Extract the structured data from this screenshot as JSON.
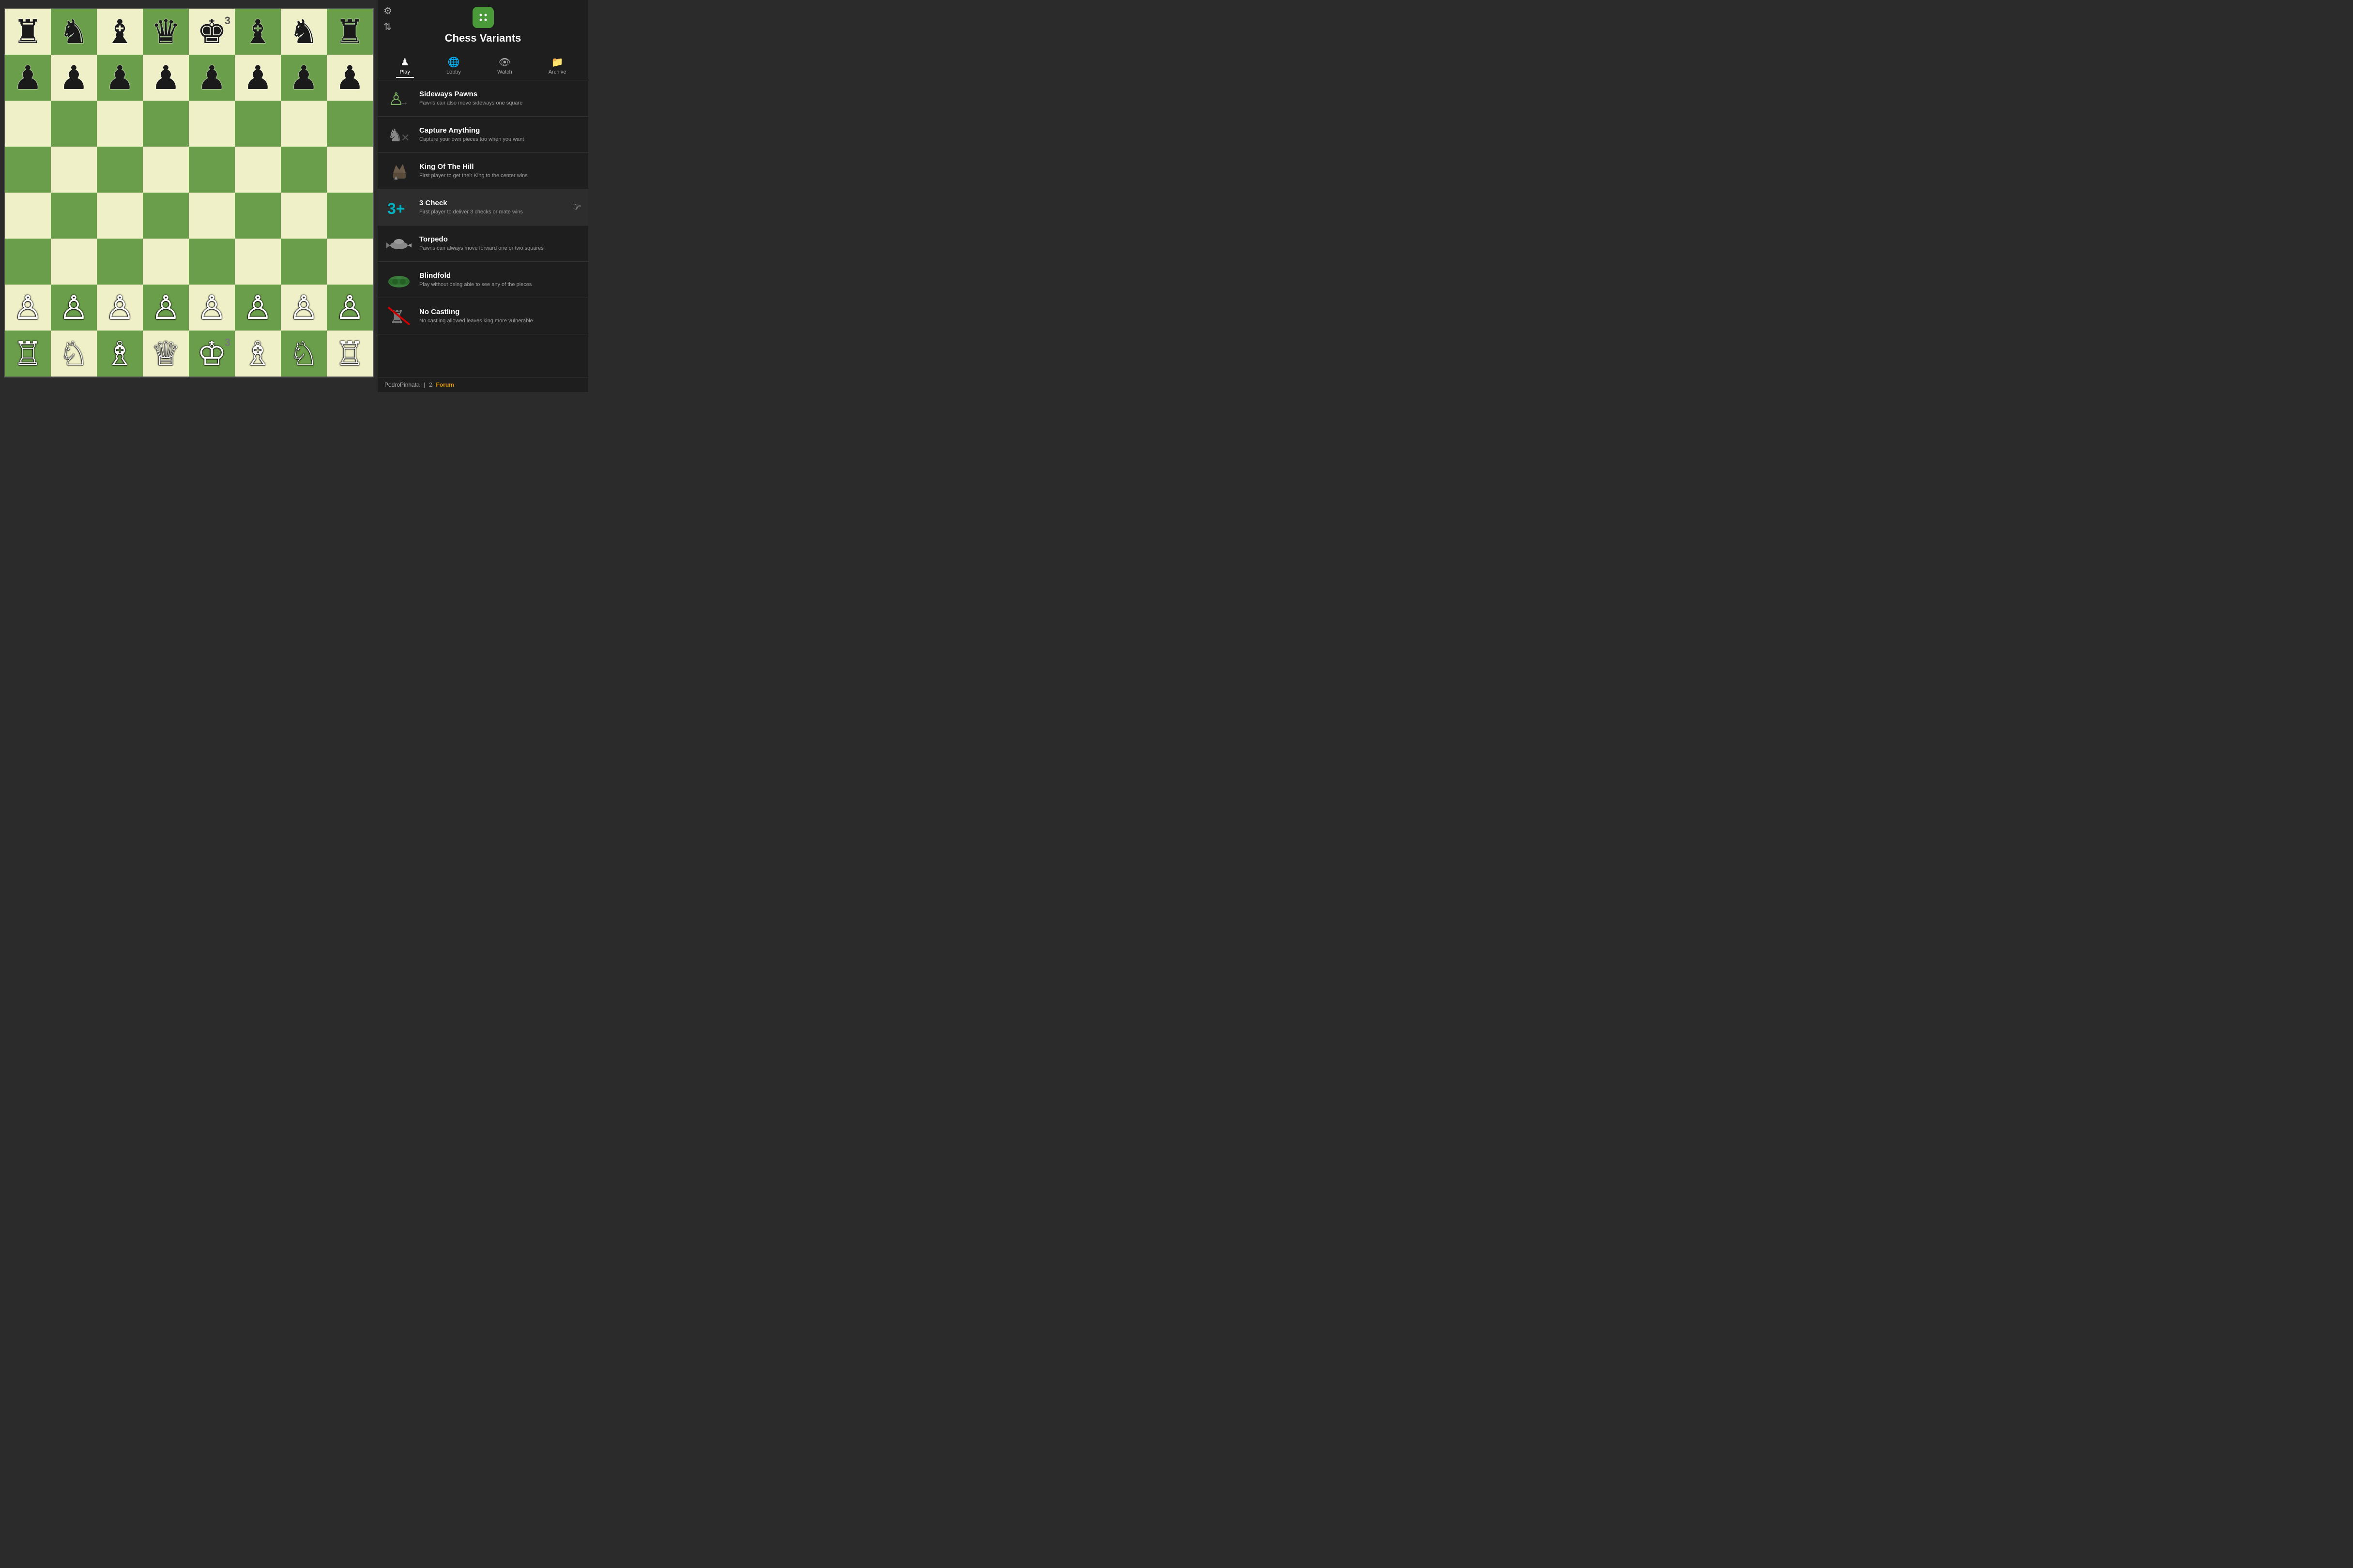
{
  "panel": {
    "title": "Chess Variants",
    "dice_icon": "🎲"
  },
  "nav": {
    "tabs": [
      {
        "id": "play",
        "label": "Play",
        "icon": "♟",
        "active": true
      },
      {
        "id": "lobby",
        "label": "Lobby",
        "icon": "🌐",
        "active": false
      },
      {
        "id": "watch",
        "label": "Watch",
        "icon": "👁",
        "active": false
      },
      {
        "id": "archive",
        "label": "Archive",
        "icon": "📁",
        "active": false
      }
    ]
  },
  "variants": [
    {
      "id": "sideways-pawns",
      "name": "Sideways Pawns",
      "desc": "Pawns can also move sideways one square",
      "icon": "♙"
    },
    {
      "id": "capture-anything",
      "name": "Capture Anything",
      "desc": "Capture your own pieces too when you want",
      "icon": "♞"
    },
    {
      "id": "king-of-the-hill",
      "name": "King Of The Hill",
      "desc": "First player to get their King to the center wins",
      "icon": "♔"
    },
    {
      "id": "3-check",
      "name": "3 Check",
      "desc": "First player to deliver 3 checks or mate wins",
      "icon": "3+",
      "active": true
    },
    {
      "id": "torpedo",
      "name": "Torpedo",
      "desc": "Pawns can always move forward one or two squares",
      "icon": "🐟"
    },
    {
      "id": "blindfold",
      "name": "Blindfold",
      "desc": "Play without being able to see any of the pieces",
      "icon": "🥽"
    },
    {
      "id": "no-castling",
      "name": "No Castling",
      "desc": "No castling allowed leaves king more vulnerable",
      "icon": "♜"
    }
  ],
  "footer": {
    "username": "PedroPinhata",
    "separator": "|",
    "count": "2",
    "forum_label": "Forum"
  },
  "icons": {
    "gear": "⚙",
    "arrows": "⇅"
  },
  "board": {
    "pieces": [
      [
        "br",
        "bn",
        "bb",
        "bq",
        "bk3",
        "bb",
        "bn",
        "br"
      ],
      [
        "bp",
        "bp",
        "bp",
        "bp",
        "bp",
        "bp",
        "bp",
        "bp"
      ],
      [
        "",
        "",
        "",
        "",
        "",
        "",
        "",
        ""
      ],
      [
        "",
        "",
        "",
        "",
        "",
        "",
        "",
        ""
      ],
      [
        "",
        "",
        "",
        "",
        "",
        "",
        "",
        ""
      ],
      [
        "",
        "",
        "",
        "",
        "",
        "",
        "",
        ""
      ],
      [
        "wp",
        "wp",
        "wp",
        "wp",
        "wp",
        "wp",
        "wp",
        "wp"
      ],
      [
        "wr",
        "wn",
        "wb",
        "wq",
        "wk3",
        "wb",
        "wn",
        "wr"
      ]
    ]
  }
}
